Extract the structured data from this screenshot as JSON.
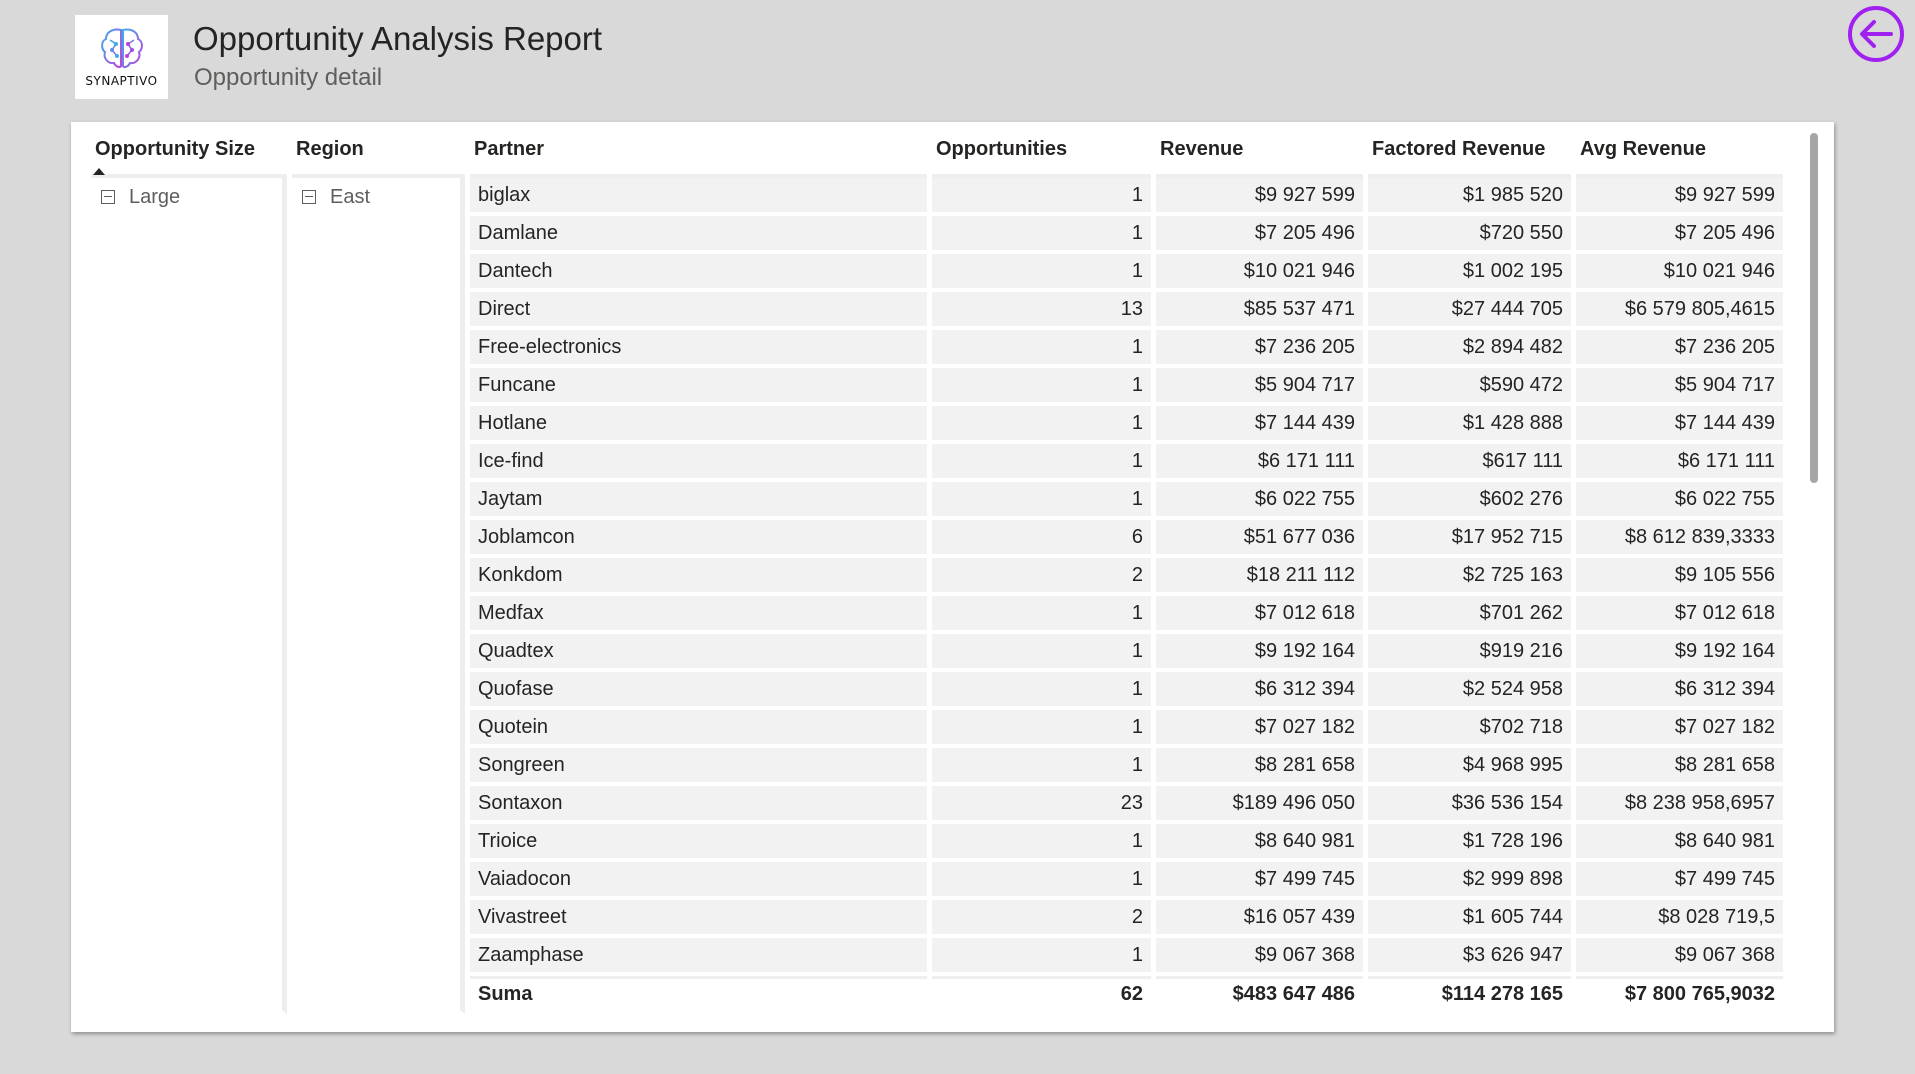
{
  "header": {
    "logo_text": "SYNAPTIVO",
    "title": "Opportunity Analysis Report",
    "subtitle": "Opportunity detail"
  },
  "colors": {
    "accent": "#a020f0"
  },
  "table": {
    "columns": [
      "Opportunity Size",
      "Region",
      "Partner",
      "Opportunities",
      "Revenue",
      "Factored Revenue",
      "Avg Revenue"
    ],
    "sort": {
      "column": "Opportunity Size",
      "direction": "ascending"
    },
    "group": {
      "size": "Large",
      "region": "East"
    },
    "rows": [
      {
        "partner": "biglax",
        "opps": "1",
        "revenue": "$9 927 599",
        "factored": "$1 985 520",
        "avg": "$9 927 599"
      },
      {
        "partner": "Damlane",
        "opps": "1",
        "revenue": "$7 205 496",
        "factored": "$720 550",
        "avg": "$7 205 496"
      },
      {
        "partner": "Dantech",
        "opps": "1",
        "revenue": "$10 021 946",
        "factored": "$1 002 195",
        "avg": "$10 021 946"
      },
      {
        "partner": "Direct",
        "opps": "13",
        "revenue": "$85 537 471",
        "factored": "$27 444 705",
        "avg": "$6 579 805,4615"
      },
      {
        "partner": "Free-electronics",
        "opps": "1",
        "revenue": "$7 236 205",
        "factored": "$2 894 482",
        "avg": "$7 236 205"
      },
      {
        "partner": "Funcane",
        "opps": "1",
        "revenue": "$5 904 717",
        "factored": "$590 472",
        "avg": "$5 904 717"
      },
      {
        "partner": "Hotlane",
        "opps": "1",
        "revenue": "$7 144 439",
        "factored": "$1 428 888",
        "avg": "$7 144 439"
      },
      {
        "partner": "Ice-find",
        "opps": "1",
        "revenue": "$6 171 111",
        "factored": "$617 111",
        "avg": "$6 171 111"
      },
      {
        "partner": "Jaytam",
        "opps": "1",
        "revenue": "$6 022 755",
        "factored": "$602 276",
        "avg": "$6 022 755"
      },
      {
        "partner": "Joblamcon",
        "opps": "6",
        "revenue": "$51 677 036",
        "factored": "$17 952 715",
        "avg": "$8 612 839,3333"
      },
      {
        "partner": "Konkdom",
        "opps": "2",
        "revenue": "$18 211 112",
        "factored": "$2 725 163",
        "avg": "$9 105 556"
      },
      {
        "partner": "Medfax",
        "opps": "1",
        "revenue": "$7 012 618",
        "factored": "$701 262",
        "avg": "$7 012 618"
      },
      {
        "partner": "Quadtex",
        "opps": "1",
        "revenue": "$9 192 164",
        "factored": "$919 216",
        "avg": "$9 192 164"
      },
      {
        "partner": "Quofase",
        "opps": "1",
        "revenue": "$6 312 394",
        "factored": "$2 524 958",
        "avg": "$6 312 394"
      },
      {
        "partner": "Quotein",
        "opps": "1",
        "revenue": "$7 027 182",
        "factored": "$702 718",
        "avg": "$7 027 182"
      },
      {
        "partner": "Songreen",
        "opps": "1",
        "revenue": "$8 281 658",
        "factored": "$4 968 995",
        "avg": "$8 281 658"
      },
      {
        "partner": "Sontaxon",
        "opps": "23",
        "revenue": "$189 496 050",
        "factored": "$36 536 154",
        "avg": "$8 238 958,6957"
      },
      {
        "partner": "Trioice",
        "opps": "1",
        "revenue": "$8 640 981",
        "factored": "$1 728 196",
        "avg": "$8 640 981"
      },
      {
        "partner": "Vaiadocon",
        "opps": "1",
        "revenue": "$7 499 745",
        "factored": "$2 999 898",
        "avg": "$7 499 745"
      },
      {
        "partner": "Vivastreet",
        "opps": "2",
        "revenue": "$16 057 439",
        "factored": "$1 605 744",
        "avg": "$8 028 719,5"
      },
      {
        "partner": "Zaamphase",
        "opps": "1",
        "revenue": "$9 067 368",
        "factored": "$3 626 947",
        "avg": "$9 067 368"
      }
    ],
    "total": {
      "label": "Suma",
      "opps": "62",
      "revenue": "$483 647 486",
      "factored": "$114 278 165",
      "avg": "$7 800 765,9032"
    }
  }
}
